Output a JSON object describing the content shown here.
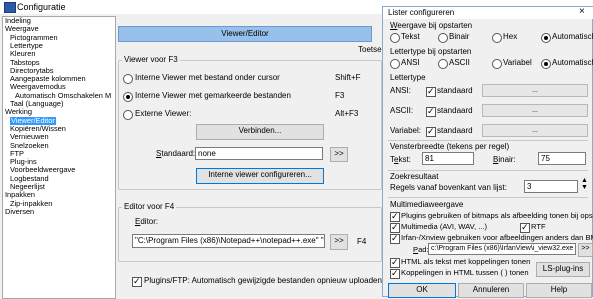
{
  "window": {
    "title": "Configuratie"
  },
  "tree": {
    "items": [
      "Indeling",
      "Weergave",
      "Pictogrammen",
      "Lettertype",
      "Kleuren",
      "Tabstops",
      "Directorytabs",
      "Aangepaste kolommen",
      "Weergavemodus",
      "Automatisch Omschakelen M",
      "Taal (Language)",
      "Werking",
      "Viewer/Editor",
      "Kopiëren/Wissen",
      "Vernieuwen",
      "Snelzoeken",
      "FTP",
      "Plug-ins",
      "Voorbeeldweergave",
      "Logbestand",
      "Negeerlijst",
      "Inpakken",
      "Zip-inpakken",
      "Diversen"
    ],
    "selected": "Viewer/Editor"
  },
  "panel": {
    "header": "Viewer/Editor",
    "toetsen_label": "Toetse",
    "viewer_group": "Viewer voor F3",
    "radio1": "Interne Viewer met bestand onder cursor",
    "radio2": "Interne Viewer met gemarkeerde bestanden",
    "radio3": "Externe Viewer:",
    "hk1": "Shift+F",
    "hk2": "F3",
    "hk3": "Alt+F3",
    "verbinden": "Verbinden...",
    "standaard_label": "Standaard:",
    "standaard_value": "none",
    "browse": ">>",
    "configure_btn": "Interne viewer configureren...",
    "editor_group": "Editor voor F4",
    "editor_label": "Editor:",
    "editor_value": "\"C:\\Program Files (x86)\\Notepad++\\notepad++.exe\" \"%1\"",
    "hk4": "F4",
    "ftp_upload": "Plugins/FTP: Automatisch gewijzigde bestanden opnieuw uploaden"
  },
  "dialog": {
    "title": "Lister configureren",
    "close": "×",
    "weergave": "Weergave bij opstarten",
    "w_opts": [
      "Tekst",
      "Binair",
      "Hex",
      "Automatisch"
    ],
    "lettertype_start": "Lettertype bij opstarten",
    "l_opts": [
      "ANSI",
      "ASCII",
      "Variabel",
      "Automatisch"
    ],
    "lettertype": "Lettertype",
    "ansi": "ANSI:",
    "ascii": "ASCII:",
    "variabel": "Variabel:",
    "standaard": "standaard",
    "dots": "...",
    "vensterbreedte": "Vensterbreedte (tekens per regel)",
    "tekst": "Tekst:",
    "tekst_val": "81",
    "binair": "Binair:",
    "binair_val": "75",
    "zoekresultaat": "Zoekresultaat",
    "regels": "Regels vanaf bovenkant van lijst:",
    "regels_val": "3",
    "multimedia": "Multimediaweergave",
    "mm1": "Plugins gebruiken of bitmaps als afbeelding tonen bij opstarten",
    "mm2": "Multimedia (AVI, WAV, ...)",
    "rtf": "RTF",
    "mm3": "Irfan-/Xnview gebruiken voor afbeeldingen anders dan BMP",
    "pad": "Pad:",
    "pad_val": "c:\\Program Files (x86)\\IrfanView\\i_view32.exe",
    "pad_btn": ">>",
    "html1": "HTML als tekst met koppelingen tonen",
    "html2": "Koppelingen in HTML tussen ( ) tonen",
    "ls_plugins": "LS-plug-ins",
    "ok": "OK",
    "annuleren": "Annuleren",
    "help": "Help"
  }
}
